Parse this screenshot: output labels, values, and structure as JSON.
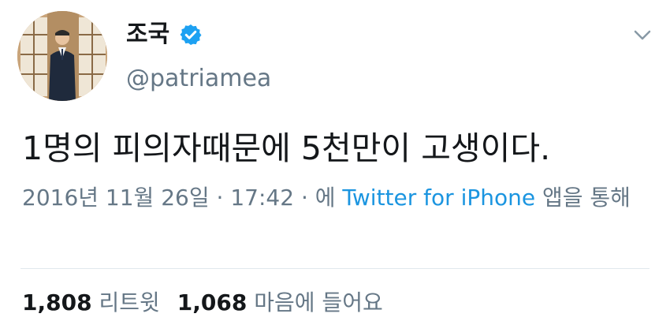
{
  "user": {
    "display_name": "조국",
    "handle": "@patriamea",
    "verified_icon": "verified-badge-icon",
    "avatar": "profile-photo"
  },
  "menu_icon": "chevron-down-icon",
  "tweet": {
    "text": "1명의 피의자때문에 5천만이 고생이다.",
    "date": "2016년 11월 26일",
    "separator": "·",
    "time": "17:42",
    "via_prefix": "에",
    "source": "Twitter for iPhone",
    "via_suffix": "앱을 통해"
  },
  "stats": {
    "retweets_count": "1,808",
    "retweets_label": "리트윗",
    "likes_count": "1,068",
    "likes_label": "마음에 들어요"
  },
  "colors": {
    "text": "#14171a",
    "secondary": "#657786",
    "link": "#1b95e0",
    "verified": "#1da1f2",
    "divider": "#e1e8ed"
  }
}
